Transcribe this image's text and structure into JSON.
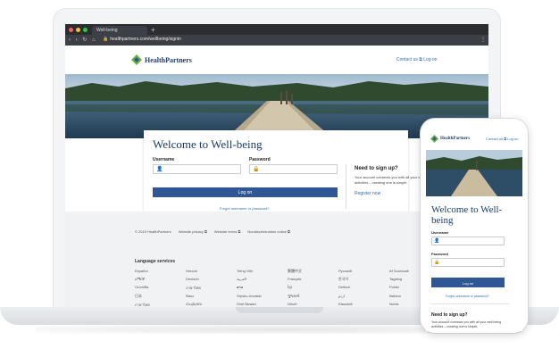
{
  "browser": {
    "tab_title": "Well-being",
    "new_tab_symbol": "+",
    "url": "healthpartners.com/wellbeing/signin",
    "nav_symbols": "‹ › ↻ ⌂",
    "lock_symbol": "🔒",
    "menu_symbol": "⋮",
    "dot_colors": [
      "#ff5f57",
      "#febc2e",
      "#28c840"
    ]
  },
  "header": {
    "logo_text": "HealthPartners",
    "contact_link": "Contact us ⧉",
    "login_link": "Log on"
  },
  "login_card": {
    "title": "Welcome to Well-being",
    "username_label": "Username",
    "password_label": "Password",
    "login_button": "Log on",
    "forgot_link": "Forgot username or password?",
    "signup_title": "Need to sign up?",
    "signup_text": "Your account connects you with all your well-being activities – creating one is simple.",
    "register_link": "Register now"
  },
  "footer": {
    "links": [
      "© 2019 HealthPartners",
      "Website privacy ⧉",
      "Website terms ⧉",
      "Nondiscrimination notice ⧉"
    ],
    "language_title": "Language services",
    "languages": [
      "Español",
      "Hmoob",
      "Tiếng Việt",
      "繁體中文",
      "Русский",
      "Af Soomaali",
      "አማርኛ",
      "Deutsch",
      "العربية",
      "Français",
      "한국어",
      "Tagalog",
      "Oromiffa",
      "ภาษาไทย",
      "ລາວ",
      "ខ្មែរ",
      "Deitsch",
      "Polski",
      "日本",
      "Ɓasɔ",
      "Srpsko-hrvatski",
      "ગુજરાતી",
      "اردو",
      "Italiano",
      "ภาษาไทย",
      "Հայերեն",
      "Diné Bizaad",
      "Nihoñ",
      "Kiswahili",
      "Norsk"
    ]
  },
  "phone": {
    "logo_text": "HealthPartners",
    "contact_link": "Contact us ⧉",
    "login_link": "Log on",
    "title": "Welcome to Well-being",
    "username_label": "Username",
    "password_label": "Password",
    "login_button": "Log on",
    "forgot_link": "Forgot username or password?",
    "signup_title": "Need to sign up?",
    "signup_text": "Your account connects you with all your well-being activities – creating one is simple."
  },
  "icons": {
    "user_icon": "👤",
    "lock_icon": "🔒"
  },
  "colors": {
    "brand_blue": "#2f5796",
    "link_blue": "#2d6fb4",
    "logo_green": "#6bb23f"
  }
}
